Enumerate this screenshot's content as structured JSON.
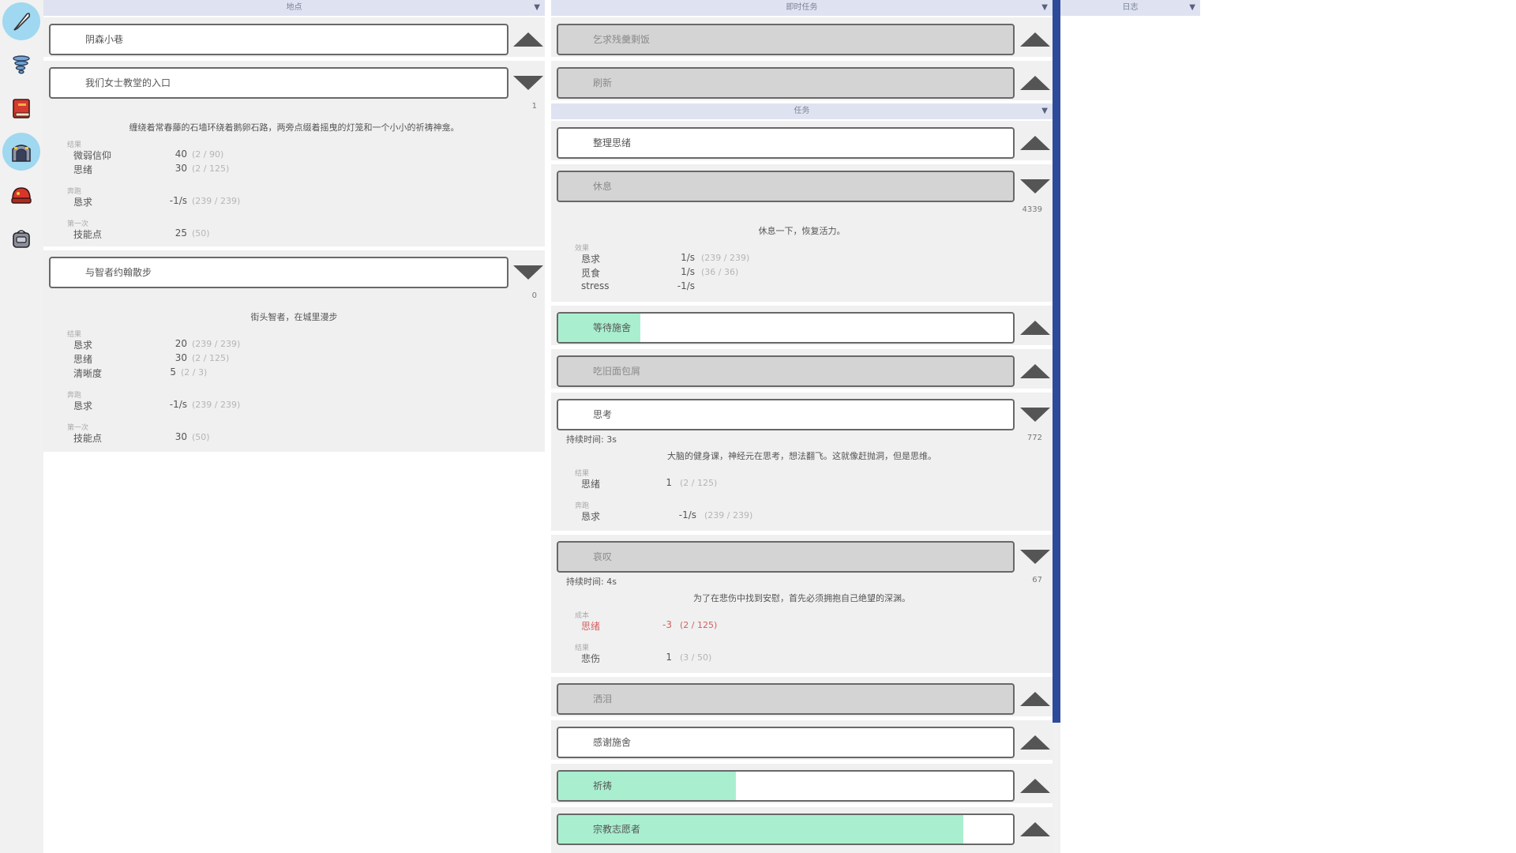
{
  "rail": [
    {
      "name": "quill-icon",
      "active": true
    },
    {
      "name": "tornado-icon",
      "active": false
    },
    {
      "name": "book-icon",
      "active": false
    },
    {
      "name": "gate-icon",
      "active": true
    },
    {
      "name": "red-cap-icon",
      "active": false
    },
    {
      "name": "knapsack-icon",
      "active": false
    }
  ],
  "locations": {
    "title": "地点",
    "caret": "▼",
    "items": [
      {
        "label": "阴森小巷",
        "toggle": "up"
      },
      {
        "label": "我们女士教堂的入口",
        "toggle": "down",
        "count": "1",
        "desc": "缠绕着常春藤的石墙环绕着鹅卵石路，两旁点缀着摇曳的灯笼和一个小小的祈祷神龛。",
        "sections": [
          {
            "title": "结果",
            "rows": [
              {
                "name": "微弱信仰",
                "val": "40",
                "max": "(2 / 90)"
              },
              {
                "name": "思绪",
                "val": "30",
                "max": "(2 / 125)"
              }
            ]
          },
          {
            "title": "奔跑",
            "rows": [
              {
                "name": "恳求",
                "val": "-1/s",
                "max": "(239 / 239)"
              }
            ]
          },
          {
            "title": "第一次",
            "rows": [
              {
                "name": "技能点",
                "val": "25",
                "max": "(50)"
              }
            ]
          }
        ]
      },
      {
        "label": "与智者约翰散步",
        "toggle": "down",
        "count": "0",
        "desc": "街头智者，在城里漫步",
        "sections": [
          {
            "title": "结果",
            "rows": [
              {
                "name": "恳求",
                "val": "20",
                "max": "(239 / 239)"
              },
              {
                "name": "思绪",
                "val": "30",
                "max": "(2 / 125)"
              },
              {
                "name": "清晰度",
                "val": "5",
                "max": "(2 / 3)"
              }
            ]
          },
          {
            "title": "奔跑",
            "rows": [
              {
                "name": "恳求",
                "val": "-1/s",
                "max": "(239 / 239)"
              }
            ]
          },
          {
            "title": "第一次",
            "rows": [
              {
                "name": "技能点",
                "val": "30",
                "max": "(50)"
              }
            ]
          }
        ]
      }
    ]
  },
  "instant_tasks": {
    "title": "即时任务",
    "caret": "▼",
    "items": [
      {
        "label": "乞求残羹剩饭",
        "style": "gray"
      },
      {
        "label": "刷新",
        "style": "gray"
      }
    ]
  },
  "tasks": {
    "title": "任务",
    "caret": "▼",
    "organize": {
      "label": "整理思绪"
    },
    "rest": {
      "label": "休息",
      "count": "4339",
      "desc": "休息一下，恢复活力。",
      "section": "效果",
      "rows": [
        {
          "name": "恳求",
          "val": "1/s",
          "max": "(239 / 239)"
        },
        {
          "name": "觅食",
          "val": "1/s",
          "max": "(36 / 36)"
        },
        {
          "name": "stress",
          "val": "-1/s",
          "max": ""
        }
      ]
    },
    "wait_charity": {
      "label": "等待施舍",
      "progress": 0.18
    },
    "eat_bread": {
      "label": "吃旧面包屑"
    },
    "think": {
      "label": "思考",
      "duration": "持续时间: 3s",
      "count": "772",
      "desc": "大脑的健身课，神经元在思考，想法翻飞。这就像赶抛洞，但是思维。",
      "s1": "结果",
      "r1": {
        "name": "思绪",
        "val": "1",
        "max": "(2 / 125)"
      },
      "s2": "奔跑",
      "r2": {
        "name": "恳求",
        "val": "-1/s",
        "max": "(239 / 239)"
      }
    },
    "lament": {
      "label": "哀叹",
      "duration": "持续时间: 4s",
      "count": "67",
      "desc": "为了在悲伤中找到安慰，首先必须拥抱自己绝望的深渊。",
      "s1": "成本",
      "r1": {
        "name": "思绪",
        "val": "-3",
        "max": "(2 / 125)"
      },
      "s2": "结果",
      "r2": {
        "name": "悲伤",
        "val": "1",
        "max": "(3 / 50)"
      }
    },
    "shed_tears": {
      "label": "洒泪"
    },
    "thank_charity": {
      "label": "感谢施舍"
    },
    "pray": {
      "label": "祈祷",
      "progress": 0.39
    },
    "volunteer": {
      "label": "宗教志愿者",
      "progress": 0.89
    }
  },
  "log": {
    "title": "日志",
    "caret": "▼"
  }
}
